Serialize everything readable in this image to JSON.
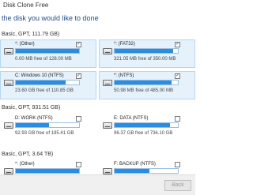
{
  "window": {
    "title": "Disk Clone Free"
  },
  "prompt": "the disk you would like to done",
  "disks": [
    {
      "header": "Basic, GPT, 111.79 GB)",
      "partitions": [
        {
          "name": "*: (Other)",
          "free": "0.00 MB free of 128.00 MB",
          "fill": 1.0,
          "checked": "✓",
          "selected": true
        },
        {
          "name": "*: (FAT32)",
          "free": "321.05 MB free of 350.00 MB",
          "fill": 0.92,
          "checked": "✓",
          "selected": true
        },
        {
          "name": "C: Windows 10 (NTFS)",
          "free": "23.60 GB free of 110.85 GB",
          "fill": 0.79,
          "checked": "✓",
          "selected": true
        },
        {
          "name": "*: (NTFS)",
          "free": "50.98 MB free of 485.00 MB",
          "fill": 0.9,
          "checked": "✓",
          "selected": true
        }
      ]
    },
    {
      "header": "Basic, GPT, 931.51 GB)",
      "partitions": [
        {
          "name": "D: WORK (NTFS)",
          "free": "92.93 GB free of 195.41 GB",
          "fill": 0.52,
          "checked": "",
          "selected": false
        },
        {
          "name": "E: DATA (NTFS)",
          "free": "96.37 GB free of 736.10 GB",
          "fill": 0.87,
          "checked": "",
          "selected": false
        }
      ]
    },
    {
      "header": "Basic, GPT, 3.64 TB)",
      "partitions": [
        {
          "name": "*: (Other)",
          "free": "",
          "fill": 1.0,
          "checked": "",
          "selected": false
        },
        {
          "name": "F: BACKUP (NTFS)",
          "free": "",
          "fill": 0.55,
          "checked": "",
          "selected": false
        }
      ]
    }
  ],
  "buttons": {
    "back": "Back"
  },
  "colors": {
    "accent": "#2b8de0",
    "selected_bg": "#e5f1fb",
    "prompt": "#1f4e8c"
  }
}
